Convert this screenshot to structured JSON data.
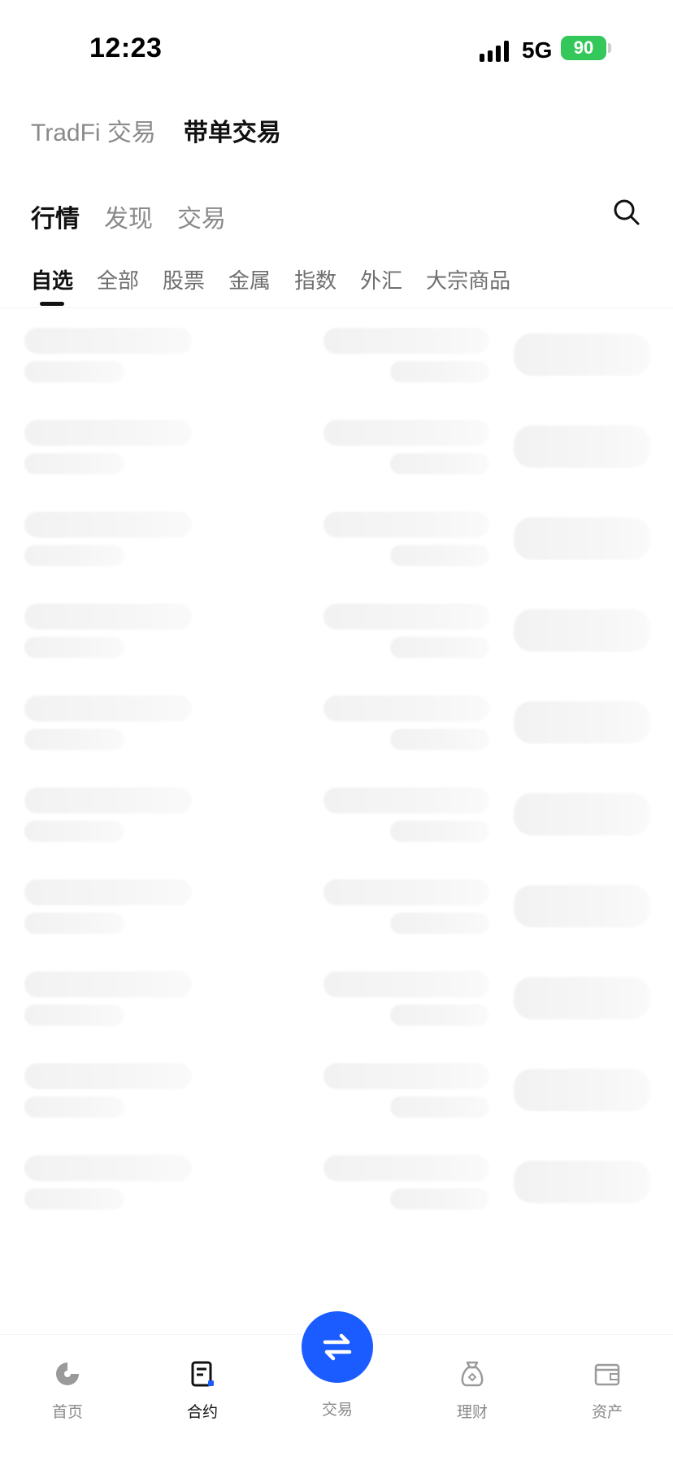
{
  "status_bar": {
    "time": "12:23",
    "network": "5G",
    "battery": "90"
  },
  "mode_tabs": [
    {
      "label": "TradFi 交易",
      "active": false
    },
    {
      "label": "带单交易",
      "active": true
    }
  ],
  "main_tabs": [
    {
      "label": "行情",
      "active": true
    },
    {
      "label": "发现",
      "active": false
    },
    {
      "label": "交易",
      "active": false
    }
  ],
  "category_tabs": [
    {
      "label": "自选",
      "active": true
    },
    {
      "label": "全部",
      "active": false
    },
    {
      "label": "股票",
      "active": false
    },
    {
      "label": "金属",
      "active": false
    },
    {
      "label": "指数",
      "active": false
    },
    {
      "label": "外汇",
      "active": false
    },
    {
      "label": "大宗商品",
      "active": false
    }
  ],
  "skeleton_rows": 10,
  "bottom_nav": [
    {
      "label": "首页",
      "icon": "home-icon",
      "active": false
    },
    {
      "label": "合约",
      "icon": "contract-icon",
      "active": true
    },
    {
      "label": "交易",
      "icon": "swap-arrows-icon",
      "active": false
    },
    {
      "label": "理财",
      "icon": "finance-bag-icon",
      "active": false
    },
    {
      "label": "资产",
      "icon": "wallet-icon",
      "active": false
    }
  ],
  "colors": {
    "accent": "#1a5cff",
    "battery": "#34c759"
  }
}
